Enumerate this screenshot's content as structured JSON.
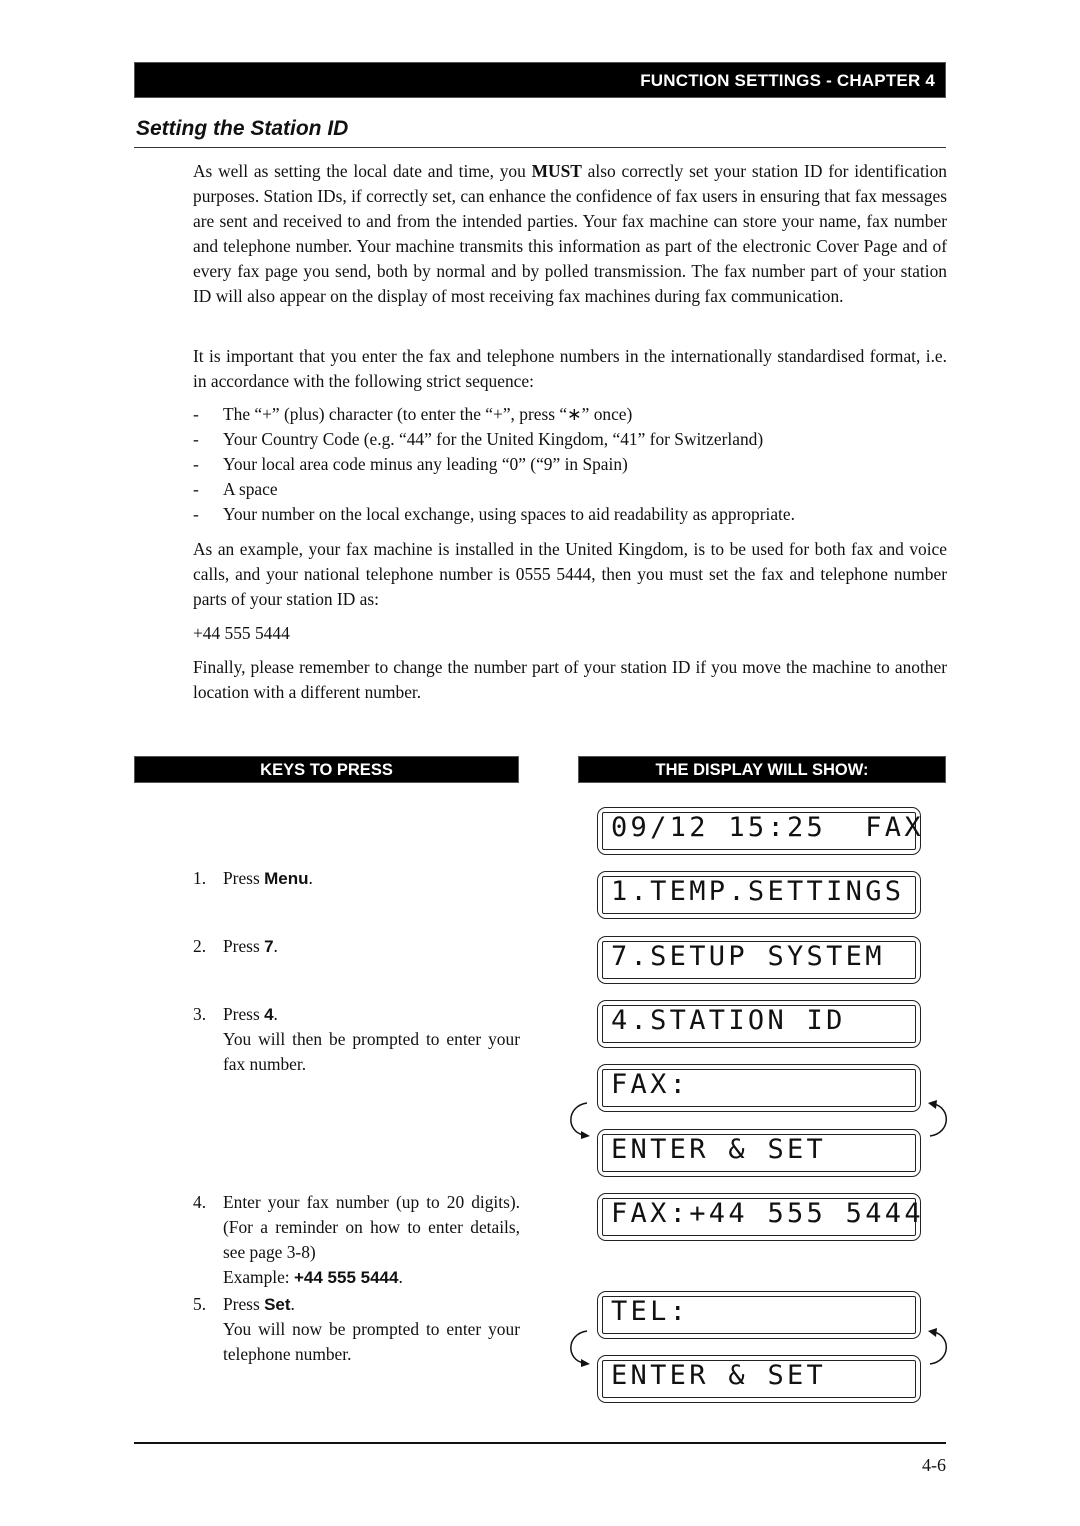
{
  "header": {
    "chapter_label": "FUNCTION SETTINGS - CHAPTER 4",
    "section_title": "Setting the Station ID"
  },
  "intro": {
    "p1_before": "As well as setting the local date and time, you ",
    "p1_emphasis": "MUST",
    "p1_after": " also correctly set your station ID for identification purposes.  Station IDs, if correctly set, can enhance the confidence of fax users in ensuring that fax messages are sent and received to and from the intended parties. Your fax machine can store your name, fax number and telephone number.  Your machine transmits this information as part of the electronic Cover Page and of every fax page you send, both by normal and by polled transmission.  The fax number part of your station ID will also appear on the display of most receiving fax machines during fax communication.",
    "p2": "It is important that you enter the fax and telephone numbers in the internationally standardised format, i.e. in accordance with the following strict sequence:",
    "sequence": [
      "The “+” (plus) character (to enter the “+”, press “∗” once)",
      "Your Country Code (e.g. “44” for the United Kingdom, “41” for Switzerland)",
      "Your local area code minus any leading “0” (“9” in Spain)",
      "A space",
      "Your number on the local exchange, using spaces to aid readability as appropriate."
    ],
    "bullet_marker": "-",
    "p3": "As an example, your fax machine is installed in the United Kingdom, is to be used for both fax and voice calls, and your national telephone number is 0555 5444, then you must set the fax and telephone number parts of your station ID as:",
    "example_number": "+44 555 5444",
    "p4": "Finally, please remember to change the number part of your station ID if you move the machine to another location with a different  number."
  },
  "table": {
    "keys_header": "KEYS TO PRESS",
    "display_header": "THE DISPLAY WILL SHOW:",
    "steps": [
      {
        "num": "1.",
        "prefix": "Press ",
        "key": "Menu",
        "suffix": ".",
        "note": ""
      },
      {
        "num": "2.",
        "prefix": "Press ",
        "key": "7",
        "suffix": ".",
        "note": ""
      },
      {
        "num": "3.",
        "prefix": "Press ",
        "key": "4",
        "suffix": ".",
        "note": "You will then be prompted to enter your fax number."
      },
      {
        "num": "4.",
        "text": "Enter your fax number (up to 20 digits). (For a reminder on how to enter details, see page 3-8)",
        "example_label": "Example: ",
        "example_value": "+44 555 5444",
        "example_suffix": "."
      },
      {
        "num": "5.",
        "prefix": "Press ",
        "key": "Set",
        "suffix": ".",
        "note": "You will now be prompted to enter your telephone number."
      }
    ],
    "lcd_screens": [
      "09/12 15:25  FAX",
      "1.TEMP.SETTINGS",
      "7.SETUP SYSTEM",
      "4.STATION ID",
      "FAX:",
      "ENTER & SET",
      "FAX:+44 555 5444",
      "TEL:",
      "ENTER & SET"
    ]
  },
  "footer": {
    "page_number": "4-6"
  }
}
